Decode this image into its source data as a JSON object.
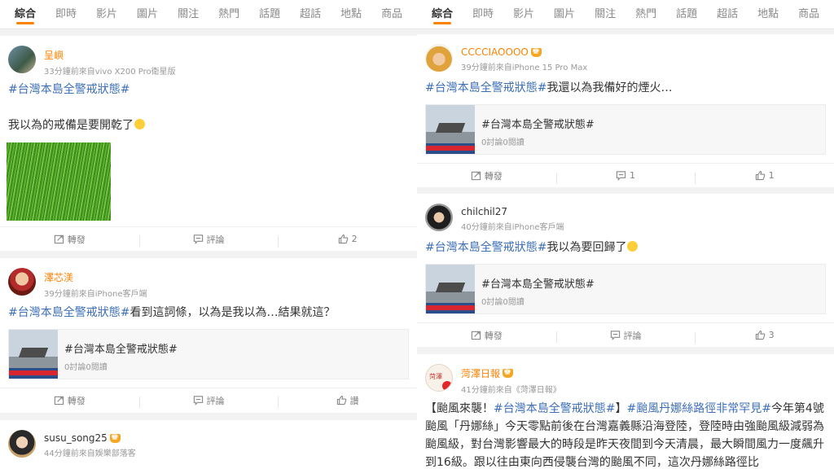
{
  "left": {
    "tabs": [
      "綜合",
      "即時",
      "影片",
      "圖片",
      "關注",
      "熱門",
      "話題",
      "超話",
      "地點",
      "商品"
    ],
    "posts": [
      {
        "name": "呈嶼",
        "sub": "33分鐘前來自vivo X200 Pro衛星版",
        "hashtag": "#台灣本島全警戒狀態#",
        "body": "我以為的戒備是要開乾了",
        "actions": {
          "repost": "轉發",
          "comment": "評論",
          "like": "2"
        }
      },
      {
        "name": "澤芯渼",
        "sub": "39分鐘前來自iPhone客戶端",
        "hashtag": "#台灣本島全警戒狀態#",
        "after": "看到這詞條，以為是我以為…結果就這？",
        "card_title": "#台灣本島全警戒狀態#",
        "card_sub": "0討論0閱讀",
        "actions": {
          "repost": "轉發",
          "comment": "評論",
          "like": "讚"
        }
      },
      {
        "name": "susu_song25",
        "sub": "44分鐘前來自娛樂部落客"
      }
    ]
  },
  "right": {
    "tabs": [
      "綜合",
      "即時",
      "影片",
      "圖片",
      "關注",
      "熱門",
      "話題",
      "超話",
      "地點",
      "商品"
    ],
    "posts": [
      {
        "name": "CCCCIAOOOO",
        "sub": "39分鐘前來自iPhone 15 Pro Max",
        "hashtag": "#台灣本島全警戒狀態#",
        "after": "我還以為我備好的煙火…",
        "card_title": "#台灣本島全警戒狀態#",
        "card_sub": "0討論0閱讀",
        "actions": {
          "repost": "轉發",
          "comment": "1",
          "like": "1"
        }
      },
      {
        "name": "chilchil27",
        "sub": "40分鐘前來自iPhone客戶端",
        "hashtag": "#台灣本島全警戒狀態#",
        "after": "我以為要回歸了",
        "card_title": "#台灣本島全警戒狀態#",
        "card_sub": "0討論0閱讀",
        "actions": {
          "repost": "轉發",
          "comment": "評論",
          "like": "3"
        }
      },
      {
        "name": "菏澤日報",
        "sub": "41分鐘前來自《菏澤日報》",
        "segments": [
          {
            "t": "【颱風來襲！",
            "h": false
          },
          {
            "t": "#台灣本島全警戒狀態#",
            "h": true
          },
          {
            "t": "】",
            "h": false
          },
          {
            "t": "#颱風丹娜絲路徑非常罕見#",
            "h": true
          },
          {
            "t": "今年第4號颱風「丹娜絲」今天零點前後在台灣嘉義縣沿海登陸，登陸時由強颱風級減弱為颱風級，對台灣影響最大的時段是昨天夜間到今天清晨，最大瞬間風力一度飆升到16級。跟以往由東向西侵襲台灣的颱風不同，這次丹娜絲路徑比",
            "h": false
          }
        ]
      }
    ]
  },
  "colors": {
    "accent": "#ff8200",
    "hashtag": "#3d6fb6"
  }
}
